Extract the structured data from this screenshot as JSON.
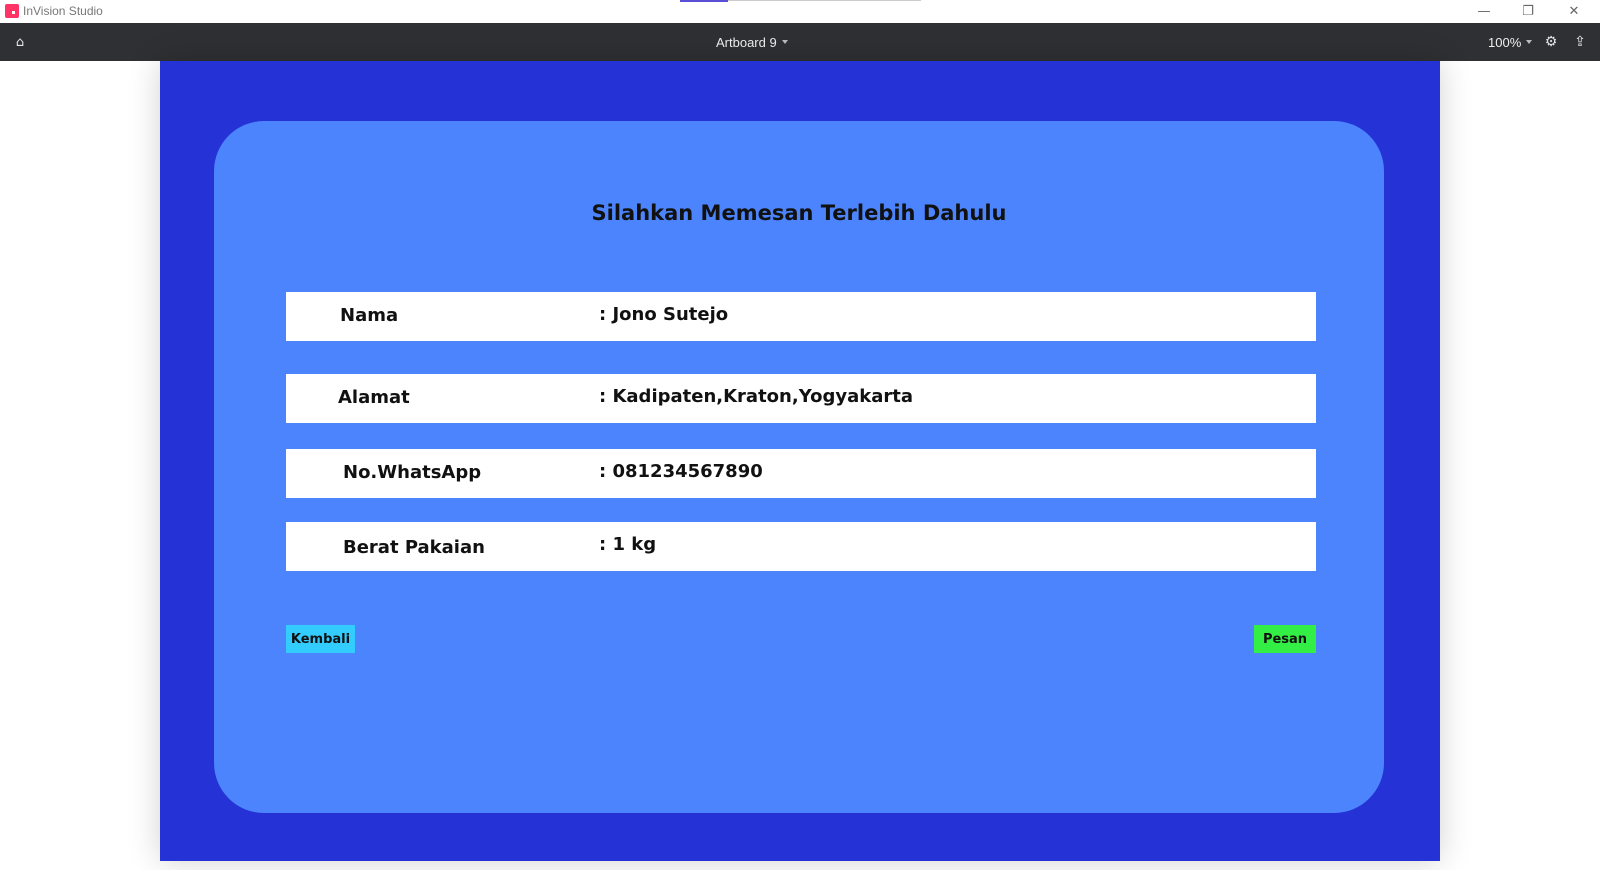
{
  "window": {
    "app_title": "InVision Studio",
    "minimize_glyph": "—",
    "maximize_glyph": "❐",
    "close_glyph": "✕"
  },
  "toolbar": {
    "home_icon": "⌂",
    "artboard_label": "Artboard 9",
    "zoom_label": "100%",
    "settings_icon": "⚙",
    "share_icon": "⇪"
  },
  "form": {
    "title": "Silahkan Memesan Terlebih Dahulu",
    "fields": [
      {
        "label": "Nama",
        "value": ": Jono Sutejo"
      },
      {
        "label": "Alamat",
        "value": ": Kadipaten,Kraton,Yogyakarta"
      },
      {
        "label": "No.WhatsApp",
        "value": ": 081234567890"
      },
      {
        "label": "Berat Pakaian",
        "value": ": 1 kg"
      }
    ],
    "back_label": "Kembali",
    "order_label": "Pesan"
  },
  "colors": {
    "artboard_bg": "#2432d6",
    "card_bg": "#4b84fc",
    "back_button": "#33ccff",
    "order_button": "#33ee44",
    "toolbar_bg": "#2e3033",
    "logo": "#ff3366"
  }
}
